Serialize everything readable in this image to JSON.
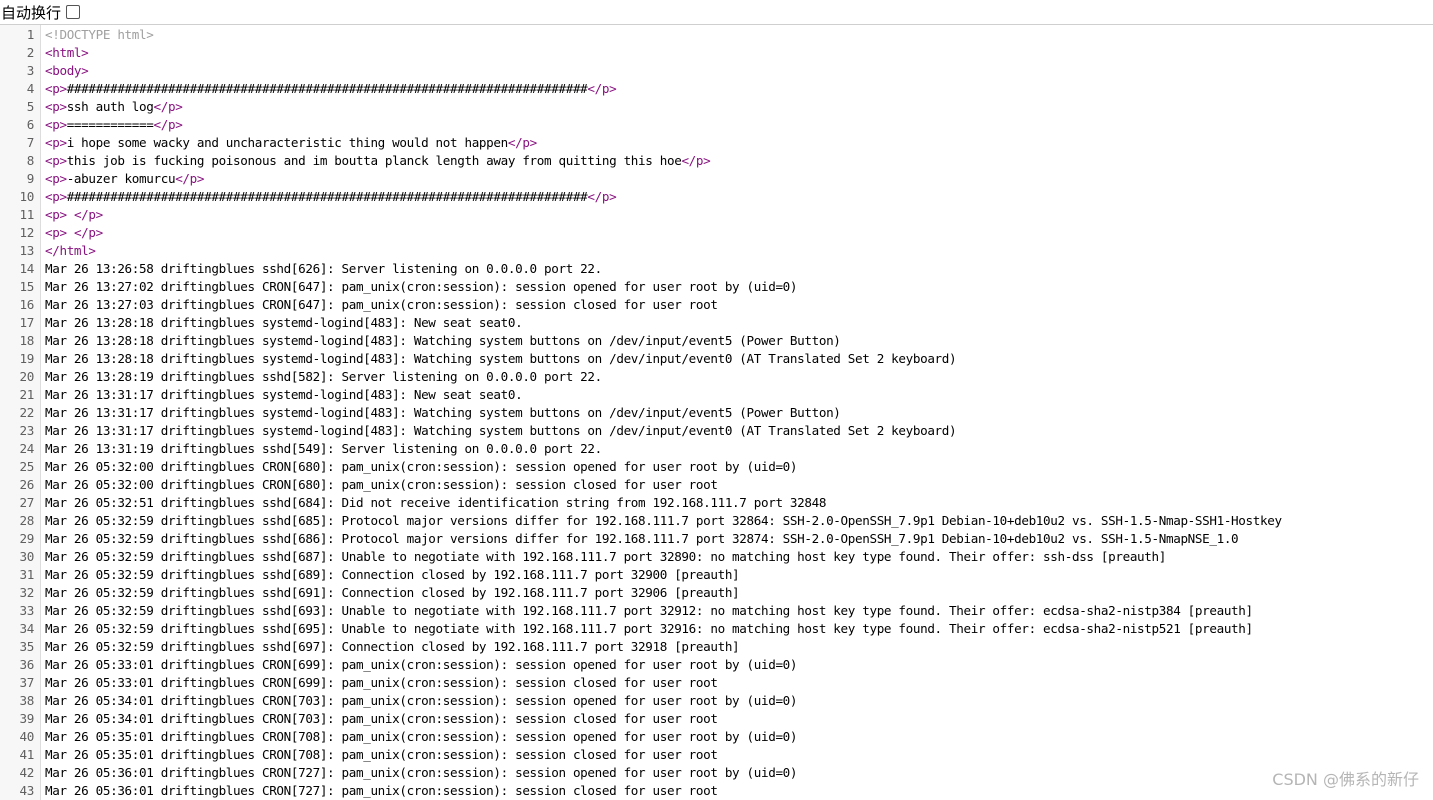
{
  "toolbar": {
    "wrap_label": "自动换行",
    "wrap_checked": false
  },
  "lines": [
    {
      "n": "1",
      "parts": [
        {
          "t": "<!DOCTYPE html>",
          "k": "doctype"
        }
      ]
    },
    {
      "n": "2",
      "parts": [
        {
          "t": "<html>",
          "k": "tag"
        }
      ]
    },
    {
      "n": "3",
      "parts": [
        {
          "t": "<body>",
          "k": "tag"
        }
      ]
    },
    {
      "n": "4",
      "parts": [
        {
          "t": "<p>",
          "k": "tag"
        },
        {
          "t": "########################################################################",
          "k": ""
        },
        {
          "t": "</p>",
          "k": "tag"
        }
      ]
    },
    {
      "n": "5",
      "parts": [
        {
          "t": "<p>",
          "k": "tag"
        },
        {
          "t": "ssh auth log",
          "k": ""
        },
        {
          "t": "</p>",
          "k": "tag"
        }
      ]
    },
    {
      "n": "6",
      "parts": [
        {
          "t": "<p>",
          "k": "tag"
        },
        {
          "t": "============",
          "k": ""
        },
        {
          "t": "</p>",
          "k": "tag"
        }
      ]
    },
    {
      "n": "7",
      "parts": [
        {
          "t": "<p>",
          "k": "tag"
        },
        {
          "t": "i hope some wacky and uncharacteristic thing would not happen",
          "k": ""
        },
        {
          "t": "</p>",
          "k": "tag"
        }
      ]
    },
    {
      "n": "8",
      "parts": [
        {
          "t": "<p>",
          "k": "tag"
        },
        {
          "t": "this job is fucking poisonous and im boutta planck length away from quitting this hoe",
          "k": ""
        },
        {
          "t": "</p>",
          "k": "tag"
        }
      ]
    },
    {
      "n": "9",
      "parts": [
        {
          "t": "<p>",
          "k": "tag"
        },
        {
          "t": "-abuzer komurcu",
          "k": ""
        },
        {
          "t": "</p>",
          "k": "tag"
        }
      ]
    },
    {
      "n": "10",
      "parts": [
        {
          "t": "<p>",
          "k": "tag"
        },
        {
          "t": "########################################################################",
          "k": ""
        },
        {
          "t": "</p>",
          "k": "tag"
        }
      ]
    },
    {
      "n": "11",
      "parts": [
        {
          "t": "<p>",
          "k": "tag"
        },
        {
          "t": " ",
          "k": ""
        },
        {
          "t": "</p>",
          "k": "tag"
        }
      ]
    },
    {
      "n": "12",
      "parts": [
        {
          "t": "<p>",
          "k": "tag"
        },
        {
          "t": " ",
          "k": ""
        },
        {
          "t": "</p>",
          "k": "tag"
        }
      ]
    },
    {
      "n": "13",
      "parts": [
        {
          "t": "</html>",
          "k": "tag"
        }
      ]
    },
    {
      "n": "14",
      "parts": [
        {
          "t": "Mar 26 13:26:58 driftingblues sshd[626]: Server listening on 0.0.0.0 port 22.",
          "k": ""
        }
      ]
    },
    {
      "n": "15",
      "parts": [
        {
          "t": "Mar 26 13:27:02 driftingblues CRON[647]: pam_unix(cron:session): session opened for user root by (uid=0)",
          "k": ""
        }
      ]
    },
    {
      "n": "16",
      "parts": [
        {
          "t": "Mar 26 13:27:03 driftingblues CRON[647]: pam_unix(cron:session): session closed for user root",
          "k": ""
        }
      ]
    },
    {
      "n": "17",
      "parts": [
        {
          "t": "Mar 26 13:28:18 driftingblues systemd-logind[483]: New seat seat0.",
          "k": ""
        }
      ]
    },
    {
      "n": "18",
      "parts": [
        {
          "t": "Mar 26 13:28:18 driftingblues systemd-logind[483]: Watching system buttons on /dev/input/event5 (Power Button)",
          "k": ""
        }
      ]
    },
    {
      "n": "19",
      "parts": [
        {
          "t": "Mar 26 13:28:18 driftingblues systemd-logind[483]: Watching system buttons on /dev/input/event0 (AT Translated Set 2 keyboard)",
          "k": ""
        }
      ]
    },
    {
      "n": "20",
      "parts": [
        {
          "t": "Mar 26 13:28:19 driftingblues sshd[582]: Server listening on 0.0.0.0 port 22.",
          "k": ""
        }
      ]
    },
    {
      "n": "21",
      "parts": [
        {
          "t": "Mar 26 13:31:17 driftingblues systemd-logind[483]: New seat seat0.",
          "k": ""
        }
      ]
    },
    {
      "n": "22",
      "parts": [
        {
          "t": "Mar 26 13:31:17 driftingblues systemd-logind[483]: Watching system buttons on /dev/input/event5 (Power Button)",
          "k": ""
        }
      ]
    },
    {
      "n": "23",
      "parts": [
        {
          "t": "Mar 26 13:31:17 driftingblues systemd-logind[483]: Watching system buttons on /dev/input/event0 (AT Translated Set 2 keyboard)",
          "k": ""
        }
      ]
    },
    {
      "n": "24",
      "parts": [
        {
          "t": "Mar 26 13:31:19 driftingblues sshd[549]: Server listening on 0.0.0.0 port 22.",
          "k": ""
        }
      ]
    },
    {
      "n": "25",
      "parts": [
        {
          "t": "Mar 26 05:32:00 driftingblues CRON[680]: pam_unix(cron:session): session opened for user root by (uid=0)",
          "k": ""
        }
      ]
    },
    {
      "n": "26",
      "parts": [
        {
          "t": "Mar 26 05:32:00 driftingblues CRON[680]: pam_unix(cron:session): session closed for user root",
          "k": ""
        }
      ]
    },
    {
      "n": "27",
      "parts": [
        {
          "t": "Mar 26 05:32:51 driftingblues sshd[684]: Did not receive identification string from 192.168.111.7 port 32848",
          "k": ""
        }
      ]
    },
    {
      "n": "28",
      "parts": [
        {
          "t": "Mar 26 05:32:59 driftingblues sshd[685]: Protocol major versions differ for 192.168.111.7 port 32864: SSH-2.0-OpenSSH_7.9p1 Debian-10+deb10u2 vs. SSH-1.5-Nmap-SSH1-Hostkey",
          "k": ""
        }
      ]
    },
    {
      "n": "29",
      "parts": [
        {
          "t": "Mar 26 05:32:59 driftingblues sshd[686]: Protocol major versions differ for 192.168.111.7 port 32874: SSH-2.0-OpenSSH_7.9p1 Debian-10+deb10u2 vs. SSH-1.5-NmapNSE_1.0",
          "k": ""
        }
      ]
    },
    {
      "n": "30",
      "parts": [
        {
          "t": "Mar 26 05:32:59 driftingblues sshd[687]: Unable to negotiate with 192.168.111.7 port 32890: no matching host key type found. Their offer: ssh-dss [preauth]",
          "k": ""
        }
      ]
    },
    {
      "n": "31",
      "parts": [
        {
          "t": "Mar 26 05:32:59 driftingblues sshd[689]: Connection closed by 192.168.111.7 port 32900 [preauth]",
          "k": ""
        }
      ]
    },
    {
      "n": "32",
      "parts": [
        {
          "t": "Mar 26 05:32:59 driftingblues sshd[691]: Connection closed by 192.168.111.7 port 32906 [preauth]",
          "k": ""
        }
      ]
    },
    {
      "n": "33",
      "parts": [
        {
          "t": "Mar 26 05:32:59 driftingblues sshd[693]: Unable to negotiate with 192.168.111.7 port 32912: no matching host key type found. Their offer: ecdsa-sha2-nistp384 [preauth]",
          "k": ""
        }
      ]
    },
    {
      "n": "34",
      "parts": [
        {
          "t": "Mar 26 05:32:59 driftingblues sshd[695]: Unable to negotiate with 192.168.111.7 port 32916: no matching host key type found. Their offer: ecdsa-sha2-nistp521 [preauth]",
          "k": ""
        }
      ]
    },
    {
      "n": "35",
      "parts": [
        {
          "t": "Mar 26 05:32:59 driftingblues sshd[697]: Connection closed by 192.168.111.7 port 32918 [preauth]",
          "k": ""
        }
      ]
    },
    {
      "n": "36",
      "parts": [
        {
          "t": "Mar 26 05:33:01 driftingblues CRON[699]: pam_unix(cron:session): session opened for user root by (uid=0)",
          "k": ""
        }
      ]
    },
    {
      "n": "37",
      "parts": [
        {
          "t": "Mar 26 05:33:01 driftingblues CRON[699]: pam_unix(cron:session): session closed for user root",
          "k": ""
        }
      ]
    },
    {
      "n": "38",
      "parts": [
        {
          "t": "Mar 26 05:34:01 driftingblues CRON[703]: pam_unix(cron:session): session opened for user root by (uid=0)",
          "k": ""
        }
      ]
    },
    {
      "n": "39",
      "parts": [
        {
          "t": "Mar 26 05:34:01 driftingblues CRON[703]: pam_unix(cron:session): session closed for user root",
          "k": ""
        }
      ]
    },
    {
      "n": "40",
      "parts": [
        {
          "t": "Mar 26 05:35:01 driftingblues CRON[708]: pam_unix(cron:session): session opened for user root by (uid=0)",
          "k": ""
        }
      ]
    },
    {
      "n": "41",
      "parts": [
        {
          "t": "Mar 26 05:35:01 driftingblues CRON[708]: pam_unix(cron:session): session closed for user root",
          "k": ""
        }
      ]
    },
    {
      "n": "42",
      "parts": [
        {
          "t": "Mar 26 05:36:01 driftingblues CRON[727]: pam_unix(cron:session): session opened for user root by (uid=0)",
          "k": ""
        }
      ]
    },
    {
      "n": "43",
      "parts": [
        {
          "t": "Mar 26 05:36:01 driftingblues CRON[727]: pam_unix(cron:session): session closed for user root",
          "k": ""
        }
      ]
    }
  ],
  "watermark": "CSDN @佛系的新仔",
  "colors": {
    "tag": "#881280",
    "doctype": "#a0a0a0",
    "text": "#000000",
    "line_number": "#606060"
  }
}
